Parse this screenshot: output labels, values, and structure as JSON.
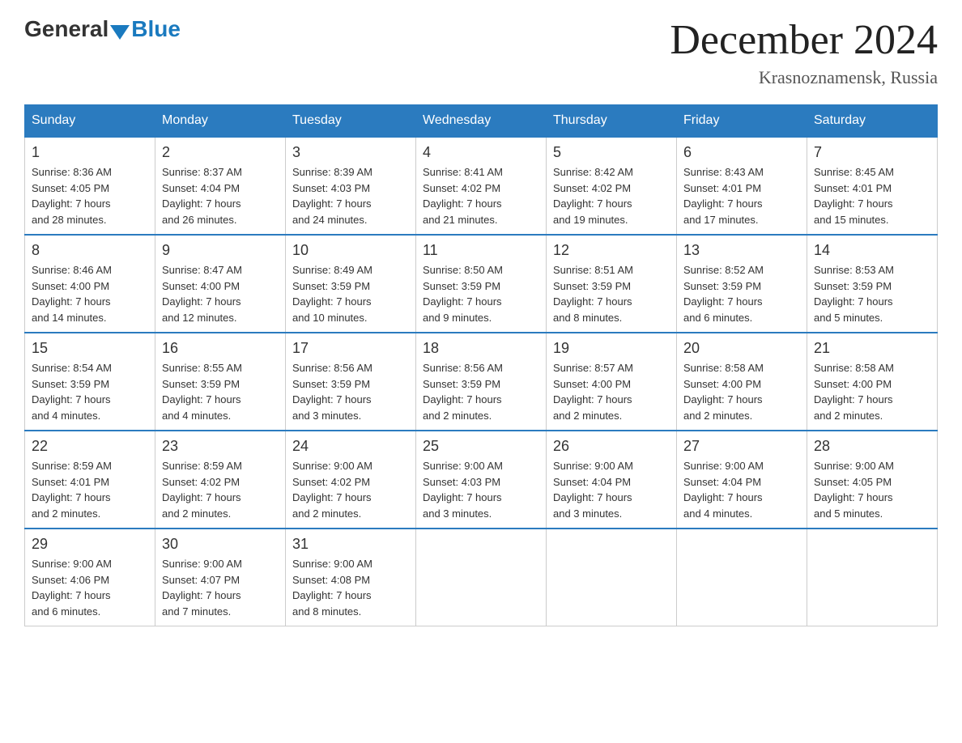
{
  "header": {
    "logo_general": "General",
    "logo_blue": "Blue",
    "month_title": "December 2024",
    "location": "Krasnoznamensk, Russia"
  },
  "days_of_week": [
    "Sunday",
    "Monday",
    "Tuesday",
    "Wednesday",
    "Thursday",
    "Friday",
    "Saturday"
  ],
  "weeks": [
    [
      {
        "day": "1",
        "sunrise": "8:36 AM",
        "sunset": "4:05 PM",
        "daylight": "7 hours and 28 minutes."
      },
      {
        "day": "2",
        "sunrise": "8:37 AM",
        "sunset": "4:04 PM",
        "daylight": "7 hours and 26 minutes."
      },
      {
        "day": "3",
        "sunrise": "8:39 AM",
        "sunset": "4:03 PM",
        "daylight": "7 hours and 24 minutes."
      },
      {
        "day": "4",
        "sunrise": "8:41 AM",
        "sunset": "4:02 PM",
        "daylight": "7 hours and 21 minutes."
      },
      {
        "day": "5",
        "sunrise": "8:42 AM",
        "sunset": "4:02 PM",
        "daylight": "7 hours and 19 minutes."
      },
      {
        "day": "6",
        "sunrise": "8:43 AM",
        "sunset": "4:01 PM",
        "daylight": "7 hours and 17 minutes."
      },
      {
        "day": "7",
        "sunrise": "8:45 AM",
        "sunset": "4:01 PM",
        "daylight": "7 hours and 15 minutes."
      }
    ],
    [
      {
        "day": "8",
        "sunrise": "8:46 AM",
        "sunset": "4:00 PM",
        "daylight": "7 hours and 14 minutes."
      },
      {
        "day": "9",
        "sunrise": "8:47 AM",
        "sunset": "4:00 PM",
        "daylight": "7 hours and 12 minutes."
      },
      {
        "day": "10",
        "sunrise": "8:49 AM",
        "sunset": "3:59 PM",
        "daylight": "7 hours and 10 minutes."
      },
      {
        "day": "11",
        "sunrise": "8:50 AM",
        "sunset": "3:59 PM",
        "daylight": "7 hours and 9 minutes."
      },
      {
        "day": "12",
        "sunrise": "8:51 AM",
        "sunset": "3:59 PM",
        "daylight": "7 hours and 8 minutes."
      },
      {
        "day": "13",
        "sunrise": "8:52 AM",
        "sunset": "3:59 PM",
        "daylight": "7 hours and 6 minutes."
      },
      {
        "day": "14",
        "sunrise": "8:53 AM",
        "sunset": "3:59 PM",
        "daylight": "7 hours and 5 minutes."
      }
    ],
    [
      {
        "day": "15",
        "sunrise": "8:54 AM",
        "sunset": "3:59 PM",
        "daylight": "7 hours and 4 minutes."
      },
      {
        "day": "16",
        "sunrise": "8:55 AM",
        "sunset": "3:59 PM",
        "daylight": "7 hours and 4 minutes."
      },
      {
        "day": "17",
        "sunrise": "8:56 AM",
        "sunset": "3:59 PM",
        "daylight": "7 hours and 3 minutes."
      },
      {
        "day": "18",
        "sunrise": "8:56 AM",
        "sunset": "3:59 PM",
        "daylight": "7 hours and 2 minutes."
      },
      {
        "day": "19",
        "sunrise": "8:57 AM",
        "sunset": "4:00 PM",
        "daylight": "7 hours and 2 minutes."
      },
      {
        "day": "20",
        "sunrise": "8:58 AM",
        "sunset": "4:00 PM",
        "daylight": "7 hours and 2 minutes."
      },
      {
        "day": "21",
        "sunrise": "8:58 AM",
        "sunset": "4:00 PM",
        "daylight": "7 hours and 2 minutes."
      }
    ],
    [
      {
        "day": "22",
        "sunrise": "8:59 AM",
        "sunset": "4:01 PM",
        "daylight": "7 hours and 2 minutes."
      },
      {
        "day": "23",
        "sunrise": "8:59 AM",
        "sunset": "4:02 PM",
        "daylight": "7 hours and 2 minutes."
      },
      {
        "day": "24",
        "sunrise": "9:00 AM",
        "sunset": "4:02 PM",
        "daylight": "7 hours and 2 minutes."
      },
      {
        "day": "25",
        "sunrise": "9:00 AM",
        "sunset": "4:03 PM",
        "daylight": "7 hours and 3 minutes."
      },
      {
        "day": "26",
        "sunrise": "9:00 AM",
        "sunset": "4:04 PM",
        "daylight": "7 hours and 3 minutes."
      },
      {
        "day": "27",
        "sunrise": "9:00 AM",
        "sunset": "4:04 PM",
        "daylight": "7 hours and 4 minutes."
      },
      {
        "day": "28",
        "sunrise": "9:00 AM",
        "sunset": "4:05 PM",
        "daylight": "7 hours and 5 minutes."
      }
    ],
    [
      {
        "day": "29",
        "sunrise": "9:00 AM",
        "sunset": "4:06 PM",
        "daylight": "7 hours and 6 minutes."
      },
      {
        "day": "30",
        "sunrise": "9:00 AM",
        "sunset": "4:07 PM",
        "daylight": "7 hours and 7 minutes."
      },
      {
        "day": "31",
        "sunrise": "9:00 AM",
        "sunset": "4:08 PM",
        "daylight": "7 hours and 8 minutes."
      },
      null,
      null,
      null,
      null
    ]
  ],
  "labels": {
    "sunrise": "Sunrise:",
    "sunset": "Sunset:",
    "daylight": "Daylight:"
  }
}
